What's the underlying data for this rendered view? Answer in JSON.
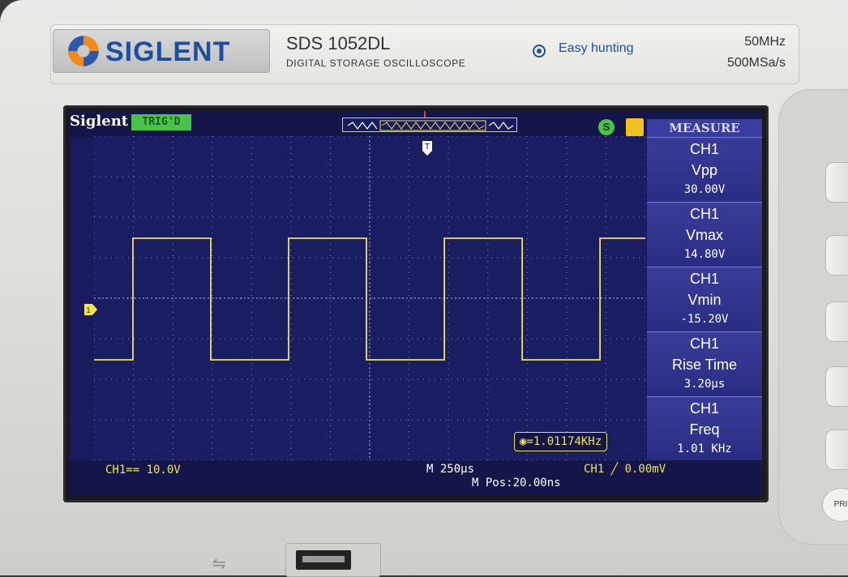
{
  "header": {
    "brand": "SIGLENT",
    "model": "SDS 1052DL",
    "model_subtitle": "DIGITAL STORAGE OSCILLOSCOPE",
    "easy_hunting": "Easy hunting",
    "spec_bandwidth": "50MHz",
    "spec_sample_rate": "500MSa/s"
  },
  "screen": {
    "brand": "Siglent",
    "run_status": "TRIG'D",
    "colors": {
      "trace": "#f0e54a",
      "background": "#1a1b5c",
      "accent": "#49c24a"
    }
  },
  "measure_panel": {
    "title": "MEASURE",
    "items": [
      {
        "channel": "CH1",
        "name": "Vpp",
        "value": "30.00V"
      },
      {
        "channel": "CH1",
        "name": "Vmax",
        "value": "14.80V"
      },
      {
        "channel": "CH1",
        "name": "Vmin",
        "value": "-15.20V"
      },
      {
        "channel": "CH1",
        "name": "Rise Time",
        "value": "3.20µs"
      },
      {
        "channel": "CH1",
        "name": "Freq",
        "value": "1.01 KHz"
      }
    ]
  },
  "readouts": {
    "freq_counter": "=1.01174KHz",
    "ch1_scale": "CH1== 10.0V",
    "timebase": "M 250µs",
    "time_position": "M Pos:20.00ns",
    "trigger": "CH1 ╱ 0.00mV"
  },
  "side_buttons": {
    "print_label": "PRI"
  },
  "waveform": {
    "type": "square",
    "high_level": 14.8,
    "low_level": -15.2,
    "frequency_hz": 1011.74
  }
}
